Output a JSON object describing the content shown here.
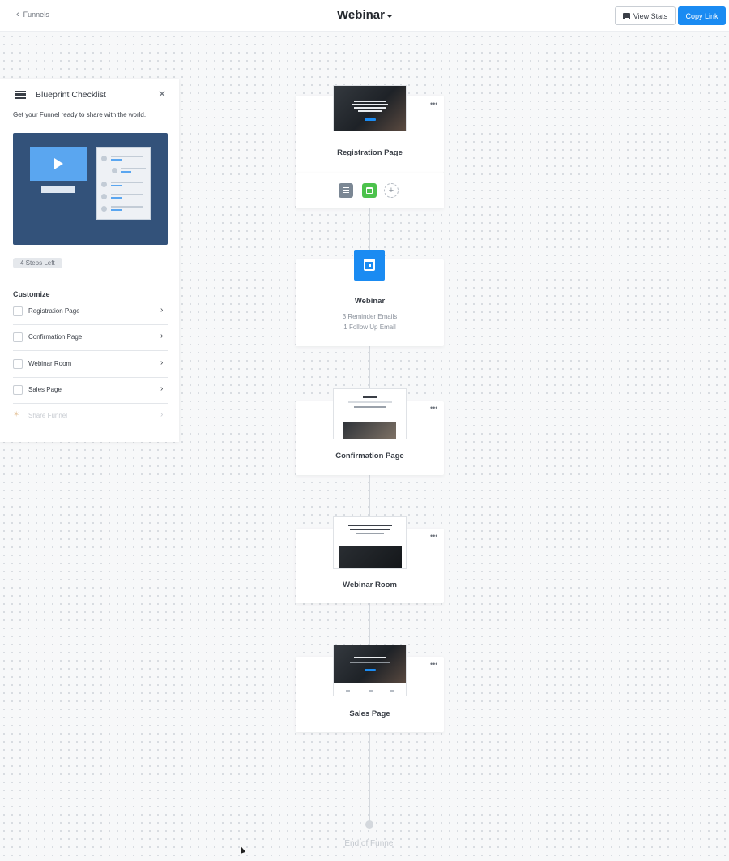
{
  "header": {
    "back_label": "Funnels",
    "title": "Webinar",
    "view_stats_label": "View Stats",
    "copy_link_label": "Copy Link"
  },
  "checklist": {
    "title": "Blueprint Checklist",
    "subtitle": "Get your Funnel ready to share with the world.",
    "steps_left": "4 Steps Left",
    "section": "Customize",
    "items": [
      {
        "label": "Registration Page",
        "enabled": true
      },
      {
        "label": "Confirmation Page",
        "enabled": true
      },
      {
        "label": "Webinar Room",
        "enabled": true
      },
      {
        "label": "Sales Page",
        "enabled": true
      },
      {
        "label": "Share Funnel",
        "enabled": false
      }
    ]
  },
  "funnel": {
    "steps": [
      {
        "label": "Registration Page"
      },
      {
        "label": "Webinar",
        "details": [
          "3 Reminder Emails",
          "1 Follow Up Email"
        ]
      },
      {
        "label": "Confirmation Page"
      },
      {
        "label": "Webinar Room"
      },
      {
        "label": "Sales Page"
      }
    ],
    "menu_glyph": "•••",
    "add_glyph": "+",
    "end_label": "End of Funnel"
  },
  "icons": {
    "back": "chevron-left-icon",
    "stats": "chart-icon",
    "checklist": "list-icon",
    "close": "close-icon",
    "calendar": "calendar-icon"
  },
  "colors": {
    "accent": "#1a8bf2",
    "green": "#4cc24c",
    "gray_action": "#7b8794",
    "blueprint_bg": "#33527a"
  }
}
